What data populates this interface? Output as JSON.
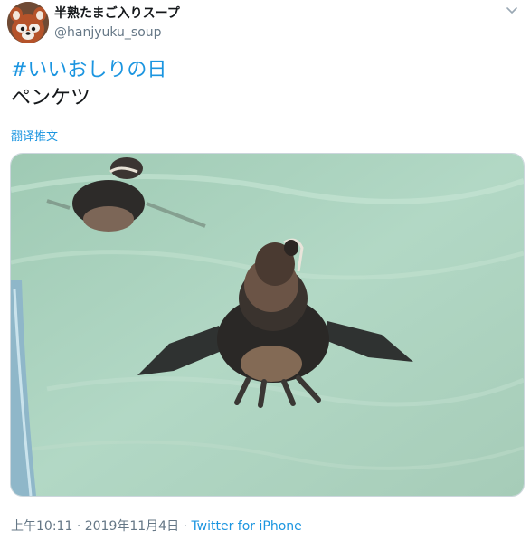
{
  "tweet": {
    "display_name": "半熟たまご入りスープ",
    "handle": "@hanjyuku_soup",
    "hashtag": "#いいおしりの日",
    "text": "ペンケツ",
    "translate_label": "翻译推文",
    "time": "上午10:11",
    "separator": "·",
    "date": "2019年11月4日",
    "source": "Twitter for iPhone"
  },
  "icons": {
    "avatar": "red-panda-avatar",
    "menu": "chevron-down-icon"
  },
  "colors": {
    "link": "#1b95e0",
    "text": "#14171a",
    "secondary": "#657786",
    "water": "#a9cfb8"
  }
}
